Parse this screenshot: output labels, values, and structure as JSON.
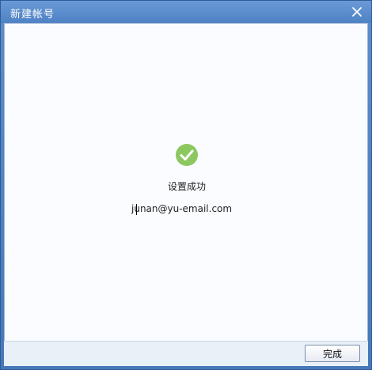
{
  "window": {
    "title": "新建帐号"
  },
  "content": {
    "status_text": "设置成功",
    "email": "junan@yu-email.com"
  },
  "footer": {
    "done_label": "完成"
  },
  "icons": {
    "close": "close-icon",
    "success": "checkmark-circle-icon"
  },
  "colors": {
    "titlebar": "#4f82c4",
    "success": "#8cc860"
  }
}
